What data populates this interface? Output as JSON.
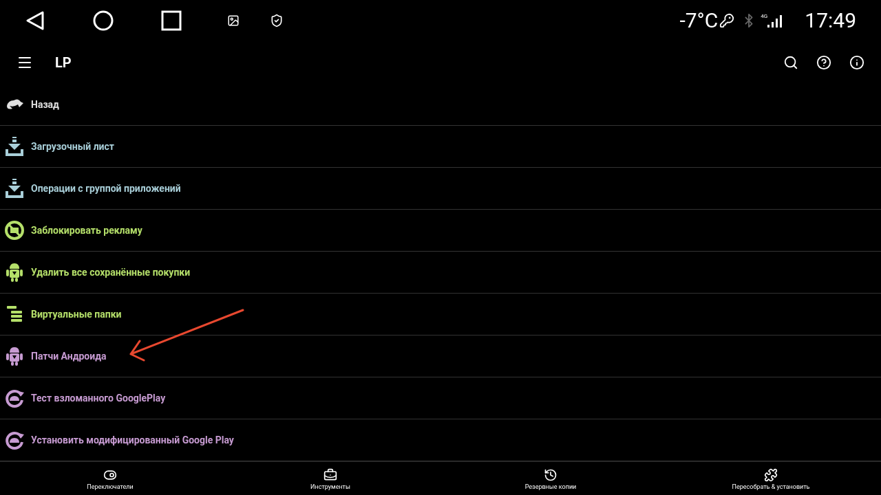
{
  "status_bar": {
    "temperature": "-7°C",
    "network": "4G",
    "time": "17:49"
  },
  "toolbar": {
    "title": "LP"
  },
  "menu": [
    {
      "label": "Назад",
      "kind": "back",
      "color": "#e0e0e0"
    },
    {
      "label": "Загрузочный лист",
      "kind": "download",
      "color": "#a9cfd9"
    },
    {
      "label": "Операции с группой приложений",
      "kind": "download",
      "color": "#a9cfd9"
    },
    {
      "label": "Заблокировать рекламу",
      "kind": "noads",
      "color": "#b5e06a"
    },
    {
      "label": "Удалить все сохранённые покупки",
      "kind": "android",
      "color": "#b5e06a"
    },
    {
      "label": "Виртуальные папки",
      "kind": "folders",
      "color": "#b5e06a"
    },
    {
      "label": "Патчи Андроида",
      "kind": "android",
      "color": "#c79bd2"
    },
    {
      "label": "Тест взломанного GooglePlay",
      "kind": "refresh",
      "color": "#c79bd2"
    },
    {
      "label": "Установить модифицированный Google Play",
      "kind": "refresh",
      "color": "#c79bd2"
    }
  ],
  "bottom_nav": [
    {
      "label": "Переключатели",
      "kind": "toggle"
    },
    {
      "label": "Инструменты",
      "kind": "toolbox"
    },
    {
      "label": "Резервные копии",
      "kind": "restore"
    },
    {
      "label": "Пересобрать & установить",
      "kind": "puzzle"
    }
  ]
}
